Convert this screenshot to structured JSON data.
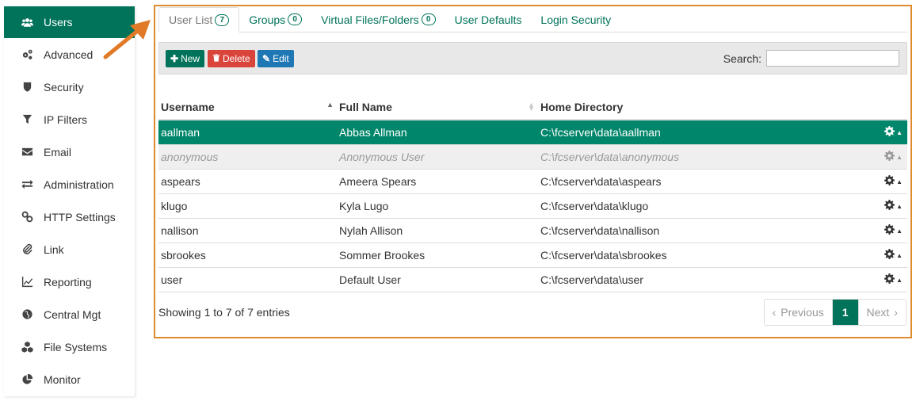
{
  "sidebar": {
    "items": [
      {
        "label": "Users",
        "icon": "users-icon"
      },
      {
        "label": "Advanced",
        "icon": "gears-icon"
      },
      {
        "label": "Security",
        "icon": "shield-icon"
      },
      {
        "label": "IP Filters",
        "icon": "filter-icon"
      },
      {
        "label": "Email",
        "icon": "envelope-icon"
      },
      {
        "label": "Administration",
        "icon": "exchange-icon"
      },
      {
        "label": "HTTP Settings",
        "icon": "link-chain-icon"
      },
      {
        "label": "Link",
        "icon": "paperclip-icon"
      },
      {
        "label": "Reporting",
        "icon": "line-chart-icon"
      },
      {
        "label": "Central Mgt",
        "icon": "globe-icon"
      },
      {
        "label": "File Systems",
        "icon": "cubes-icon"
      },
      {
        "label": "Monitor",
        "icon": "pie-chart-icon"
      }
    ]
  },
  "tabs": [
    {
      "label": "User List",
      "badge": "7"
    },
    {
      "label": "Groups",
      "badge": "0"
    },
    {
      "label": "Virtual Files/Folders",
      "badge": "0"
    },
    {
      "label": "User Defaults",
      "badge": null
    },
    {
      "label": "Login Security",
      "badge": null
    }
  ],
  "toolbar": {
    "new_label": "New",
    "delete_label": "Delete",
    "edit_label": "Edit",
    "search_label": "Search:",
    "search_value": ""
  },
  "table": {
    "headers": {
      "username": "Username",
      "fullname": "Full Name",
      "home": "Home Directory"
    },
    "rows": [
      {
        "username": "aallman",
        "fullname": "Abbas Allman",
        "home": "C:\\fcserver\\data\\aallman"
      },
      {
        "username": "anonymous",
        "fullname": "Anonymous User",
        "home": "C:\\fcserver\\data\\anonymous"
      },
      {
        "username": "aspears",
        "fullname": "Ameera Spears",
        "home": "C:\\fcserver\\data\\aspears"
      },
      {
        "username": "klugo",
        "fullname": "Kyla Lugo",
        "home": "C:\\fcserver\\data\\klugo"
      },
      {
        "username": "nallison",
        "fullname": "Nylah Allison",
        "home": "C:\\fcserver\\data\\nallison"
      },
      {
        "username": "sbrookes",
        "fullname": "Sommer Brookes",
        "home": "C:\\fcserver\\data\\sbrookes"
      },
      {
        "username": "user",
        "fullname": "Default User",
        "home": "C:\\fcserver\\data\\user"
      }
    ]
  },
  "footer": {
    "info": "Showing 1 to 7 of 7 entries",
    "previous": "Previous",
    "page": "1",
    "next": "Next"
  },
  "colors": {
    "accent": "#00735a",
    "selected_row": "#00866a",
    "delete": "#d9453b",
    "edit": "#1f78b4",
    "highlight_border": "#e08a2e"
  }
}
